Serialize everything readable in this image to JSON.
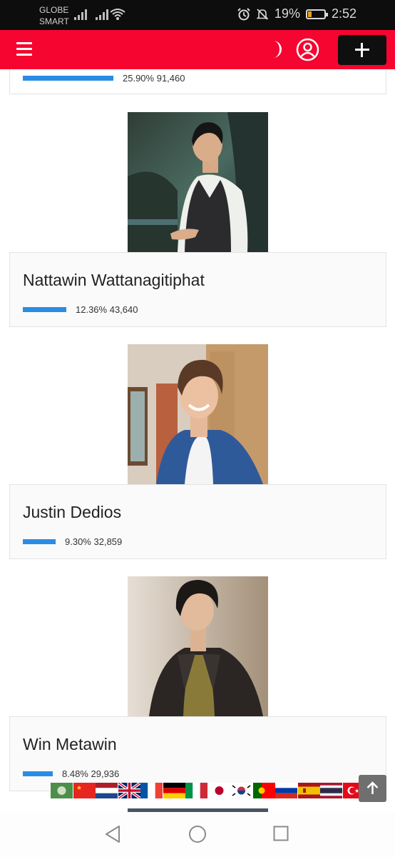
{
  "status_bar": {
    "carrier_line1": "GLOBE",
    "carrier_line2": "SMART",
    "battery": "19%",
    "time": "2:52"
  },
  "header": {
    "menu_icon": "hamburger-icon",
    "theme_icon": "moon-icon",
    "account_icon": "user-circle-icon",
    "add_icon": "plus-icon",
    "brand_color": "#f5052f"
  },
  "candidates": [
    {
      "name": "",
      "percent": "25.90%",
      "votes": "91,460",
      "share": 0.259
    },
    {
      "name": "Nattawin Wattanagitiphat",
      "percent": "12.36%",
      "votes": "43,640",
      "share": 0.1236
    },
    {
      "name": "Justin Dedios",
      "percent": "9.30%",
      "votes": "32,859",
      "share": 0.093
    },
    {
      "name": "Win Metawin",
      "percent": "8.48%",
      "votes": "29,936",
      "share": 0.0848
    }
  ],
  "bar_color": "#2a8de3",
  "languages": [
    "arabic",
    "chinese",
    "dutch",
    "english",
    "french",
    "german",
    "italian",
    "japanese",
    "korean",
    "portuguese",
    "russian",
    "spanish",
    "thai",
    "turkish"
  ],
  "scroll_top_icon": "arrow-up-icon",
  "nav": {
    "back_icon": "triangle-back-icon",
    "home_icon": "circle-home-icon",
    "recents_icon": "square-recents-icon"
  }
}
